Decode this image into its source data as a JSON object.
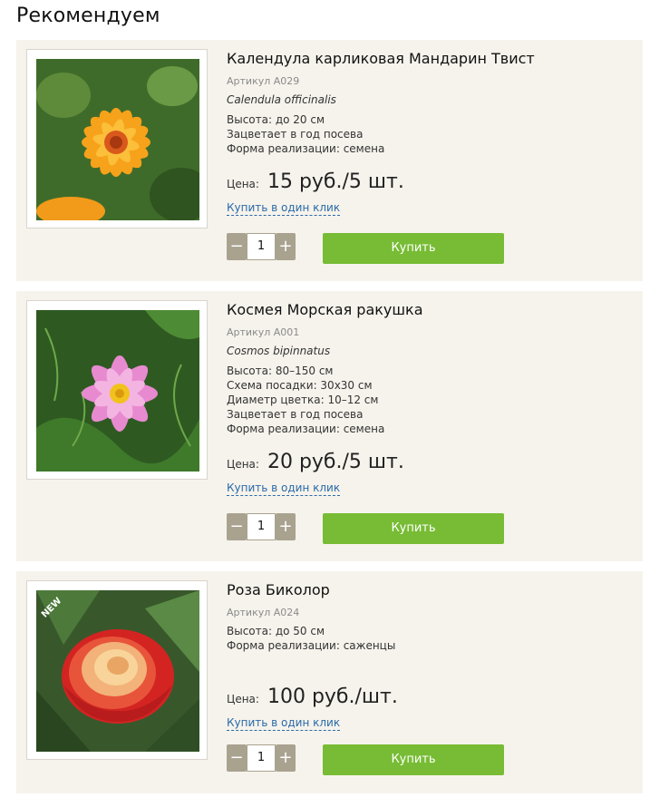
{
  "section": {
    "title": "Рекомендуем"
  },
  "products": [
    {
      "name": "Календула карликовая Мандарин Твист",
      "sku": "Артикул А029",
      "latin": "Calendula officinalis",
      "attributes": [
        "Высота: до 20 см",
        "Зацветает в год посева",
        "Форма реализации: семена"
      ],
      "price_label": "Цена:",
      "price": "15 руб./5 шт.",
      "one_click": "Купить в один клик",
      "qty_minus": "−",
      "qty": "1",
      "qty_plus": "+",
      "buy": "Купить",
      "image_icon": "calendula-photo"
    },
    {
      "name": "Космея Морская ракушка",
      "sku": "Артикул А001",
      "latin": "Cosmos bipinnatus",
      "attributes": [
        "Высота: 80–150 см",
        "Схема посадки: 30х30 см",
        "Диаметр цветка: 10–12 см",
        "Зацветает в год посева",
        "Форма реализации: семена"
      ],
      "price_label": "Цена:",
      "price": "20 руб./5 шт.",
      "one_click": "Купить в один клик",
      "qty_minus": "−",
      "qty": "1",
      "qty_plus": "+",
      "buy": "Купить",
      "image_icon": "cosmos-photo"
    },
    {
      "name": "Роза Биколор",
      "sku": "Артикул А024",
      "attributes": [
        "Высота: до 50 см",
        "Форма реализации: саженцы"
      ],
      "price_label": "Цена:",
      "price": "100 руб./шт.",
      "one_click": "Купить в один клик",
      "qty_minus": "−",
      "qty": "1",
      "qty_plus": "+",
      "buy": "Купить",
      "badge": "NEW",
      "image_icon": "rose-photo"
    }
  ],
  "colors": {
    "card_bg": "#f6f3ec",
    "buy_button": "#77bc34",
    "qty_button": "#a9a28f",
    "link": "#2a6aa8",
    "badge": "#2aa84a"
  }
}
